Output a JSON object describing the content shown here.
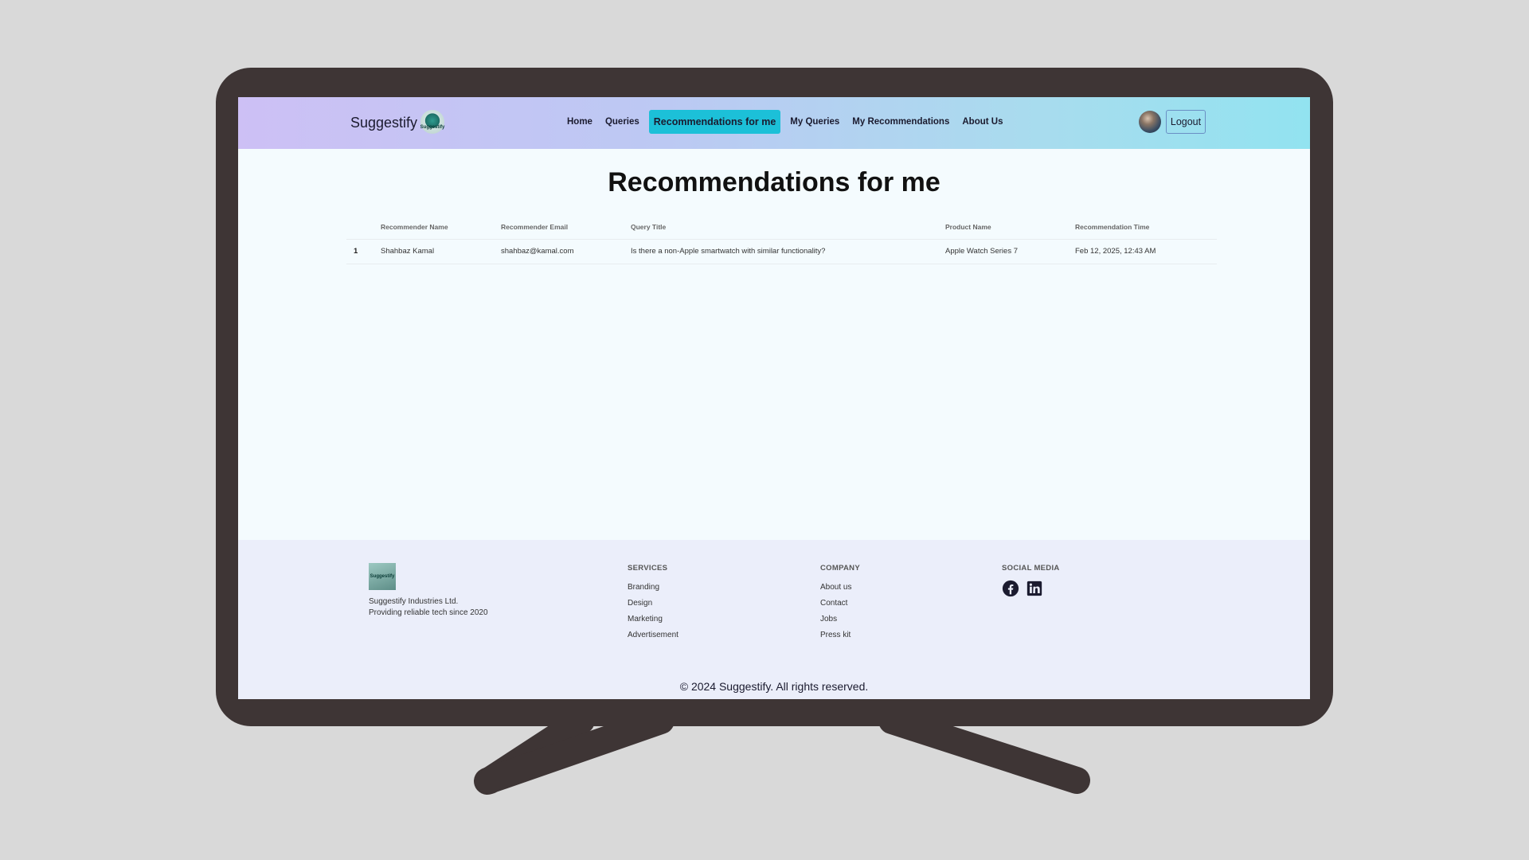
{
  "navbar": {
    "brand": "Suggestify",
    "logo_text": "Suggestify",
    "links": [
      {
        "label": "Home"
      },
      {
        "label": "Queries"
      },
      {
        "label": "Recommendations for me"
      },
      {
        "label": "My Queries"
      },
      {
        "label": "My Recommendations"
      },
      {
        "label": "About Us"
      }
    ],
    "active_index": 2,
    "logout_label": "Logout"
  },
  "main": {
    "title": "Recommendations for me",
    "columns": [
      "Recommender Name",
      "Recommender Email",
      "Query Title",
      "Product Name",
      "Recommendation Time"
    ],
    "rows": [
      {
        "index": "1",
        "name": "Shahbaz Kamal",
        "email": "shahbaz@kamal.com",
        "query": "Is there a non-Apple smartwatch with similar functionality?",
        "product": "Apple Watch Series 7",
        "time": "Feb 12, 2025, 12:43 AM"
      }
    ]
  },
  "footer": {
    "logo_text": "Suggestify",
    "company_name": "Suggestify Industries Ltd.",
    "tagline": "Providing reliable tech since 2020",
    "services": {
      "heading": "SERVICES",
      "items": [
        "Branding",
        "Design",
        "Marketing",
        "Advertisement"
      ]
    },
    "company": {
      "heading": "COMPANY",
      "items": [
        "About us",
        "Contact",
        "Jobs",
        "Press kit"
      ]
    },
    "social": {
      "heading": "SOCIAL MEDIA",
      "icons": [
        "facebook-icon",
        "linkedin-icon"
      ]
    },
    "copyright": "© 2024 Suggestify. All rights reserved."
  },
  "colors": {
    "accent": "#1cc0d8",
    "frame": "#3e3535",
    "footer_bg": "#ebeefa"
  }
}
